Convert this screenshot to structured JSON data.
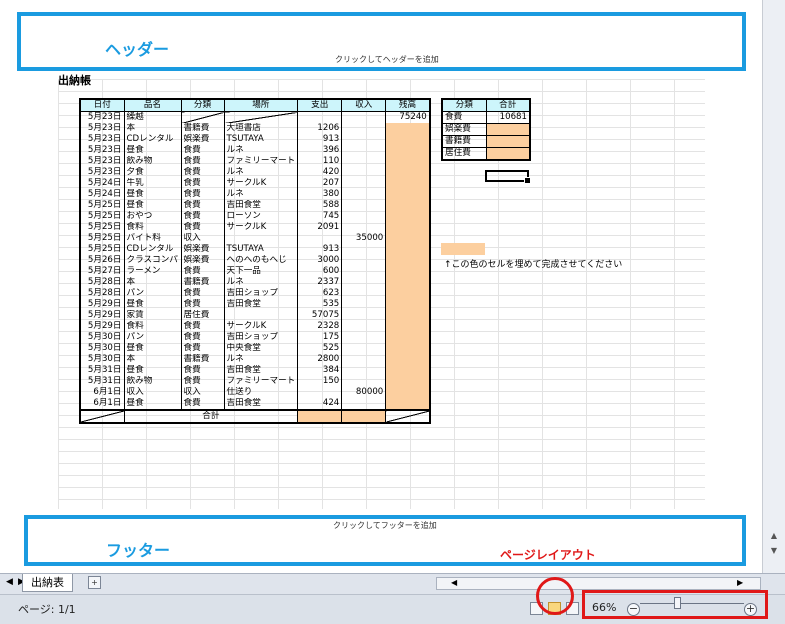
{
  "header": {
    "label": "ヘッダー",
    "hint": "クリックしてヘッダーを追加"
  },
  "footer": {
    "label": "フッター",
    "hint": "クリックしてフッターを追加"
  },
  "annotation": {
    "page_layout": "ページレイアウト"
  },
  "sheet": {
    "title": "出納帳",
    "columns": [
      "日付",
      "品名",
      "分類",
      "場所",
      "支出",
      "収入",
      "残高"
    ],
    "first_row": {
      "date": "5月23日",
      "item": "繰越",
      "balance": "75240"
    },
    "rows": [
      [
        "5月23日",
        "本",
        "書籍費",
        "大垣書店",
        "1206",
        ""
      ],
      [
        "5月23日",
        "CDレンタル",
        "娯楽費",
        "TSUTAYA",
        "913",
        ""
      ],
      [
        "5月23日",
        "昼食",
        "食費",
        "ルネ",
        "396",
        ""
      ],
      [
        "5月23日",
        "飲み物",
        "食費",
        "ファミリーマート",
        "110",
        ""
      ],
      [
        "5月23日",
        "夕食",
        "食費",
        "ルネ",
        "420",
        ""
      ],
      [
        "5月24日",
        "牛乳",
        "食費",
        "サークルK",
        "207",
        ""
      ],
      [
        "5月24日",
        "昼食",
        "食費",
        "ルネ",
        "380",
        ""
      ],
      [
        "5月25日",
        "昼食",
        "食費",
        "吉田食堂",
        "588",
        ""
      ],
      [
        "5月25日",
        "おやつ",
        "食費",
        "ローソン",
        "745",
        ""
      ],
      [
        "5月25日",
        "食料",
        "食費",
        "サークルK",
        "2091",
        ""
      ],
      [
        "5月25日",
        "バイト料",
        "収入",
        "",
        "",
        "35000"
      ],
      [
        "5月25日",
        "CDレンタル",
        "娯楽費",
        "TSUTAYA",
        "913",
        ""
      ],
      [
        "5月26日",
        "クラスコンパ",
        "娯楽費",
        "へのへのもへじ",
        "3000",
        ""
      ],
      [
        "5月27日",
        "ラーメン",
        "食費",
        "天下一品",
        "600",
        ""
      ],
      [
        "5月28日",
        "本",
        "書籍費",
        "ルネ",
        "2337",
        ""
      ],
      [
        "5月28日",
        "パン",
        "食費",
        "吉田ショップ",
        "623",
        ""
      ],
      [
        "5月29日",
        "昼食",
        "食費",
        "吉田食堂",
        "535",
        ""
      ],
      [
        "5月29日",
        "家賃",
        "居住費",
        "",
        "57075",
        ""
      ],
      [
        "5月29日",
        "食料",
        "食費",
        "サークルK",
        "2328",
        ""
      ],
      [
        "5月30日",
        "パン",
        "食費",
        "吉田ショップ",
        "175",
        ""
      ],
      [
        "5月30日",
        "昼食",
        "食費",
        "中央食堂",
        "525",
        ""
      ],
      [
        "5月30日",
        "本",
        "書籍費",
        "ルネ",
        "2800",
        ""
      ],
      [
        "5月31日",
        "昼食",
        "食費",
        "吉田食堂",
        "384",
        ""
      ],
      [
        "5月31日",
        "飲み物",
        "食費",
        "ファミリーマート",
        "150",
        ""
      ],
      [
        "6月1日",
        "収入",
        "収入",
        "仕送り",
        "",
        "80000"
      ],
      [
        "6月1日",
        "昼食",
        "食費",
        "吉田食堂",
        "424",
        ""
      ]
    ],
    "total_label": "合計"
  },
  "summary": {
    "columns": [
      "分類",
      "合計"
    ],
    "rows": [
      [
        "食費",
        "10681"
      ],
      [
        "娯楽費",
        ""
      ],
      [
        "書籍費",
        ""
      ],
      [
        "居住費",
        ""
      ]
    ]
  },
  "hint_text": "↑この色のセルを埋めて完成させてください",
  "tabbar": {
    "sheet_tab": "出納表"
  },
  "status": {
    "page": "ページ: 1/1",
    "zoom": "66%"
  },
  "colors": {
    "accent_blue": "#1a9be0",
    "highlight_orange": "#fccf9f",
    "header_cyan": "#cdf5fb",
    "annotation_red": "#e01818"
  }
}
